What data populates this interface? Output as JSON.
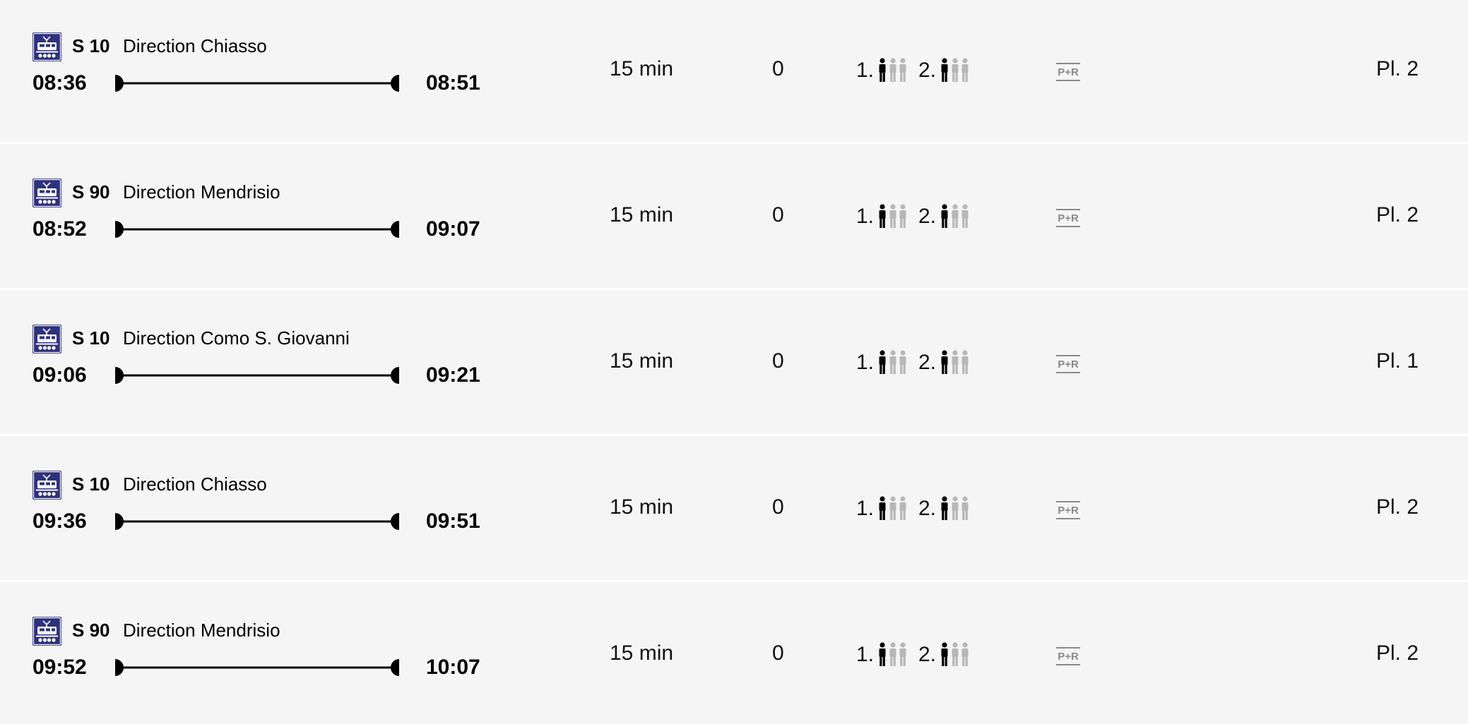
{
  "connections": [
    {
      "icon": "train-icon",
      "line": "S 10",
      "direction": "Direction Chiasso",
      "departure": "08:36",
      "arrival": "08:51",
      "duration": "15 min",
      "changes": "0",
      "occupancy": {
        "first_class_label": "1.",
        "second_class_label": "2.",
        "first_class_level": 1,
        "second_class_level": 1,
        "max_level": 3
      },
      "park_and_ride": "P+R",
      "platform": "Pl. 2"
    },
    {
      "icon": "train-icon",
      "line": "S 90",
      "direction": "Direction Mendrisio",
      "departure": "08:52",
      "arrival": "09:07",
      "duration": "15 min",
      "changes": "0",
      "occupancy": {
        "first_class_label": "1.",
        "second_class_label": "2.",
        "first_class_level": 1,
        "second_class_level": 1,
        "max_level": 3
      },
      "park_and_ride": "P+R",
      "platform": "Pl. 2"
    },
    {
      "icon": "train-icon",
      "line": "S 10",
      "direction": "Direction Como S. Giovanni",
      "departure": "09:06",
      "arrival": "09:21",
      "duration": "15 min",
      "changes": "0",
      "occupancy": {
        "first_class_label": "1.",
        "second_class_label": "2.",
        "first_class_level": 1,
        "second_class_level": 1,
        "max_level": 3
      },
      "park_and_ride": "P+R",
      "platform": "Pl. 1"
    },
    {
      "icon": "train-icon",
      "line": "S 10",
      "direction": "Direction Chiasso",
      "departure": "09:36",
      "arrival": "09:51",
      "duration": "15 min",
      "changes": "0",
      "occupancy": {
        "first_class_label": "1.",
        "second_class_label": "2.",
        "first_class_level": 1,
        "second_class_level": 1,
        "max_level": 3
      },
      "park_and_ride": "P+R",
      "platform": "Pl. 2"
    },
    {
      "icon": "train-icon",
      "line": "S 90",
      "direction": "Direction Mendrisio",
      "departure": "09:52",
      "arrival": "10:07",
      "duration": "15 min",
      "changes": "0",
      "occupancy": {
        "first_class_label": "1.",
        "second_class_label": "2.",
        "first_class_level": 1,
        "second_class_level": 1,
        "max_level": 3
      },
      "park_and_ride": "P+R",
      "platform": "Pl. 2"
    }
  ],
  "colors": {
    "background": "#f5f5f5",
    "row_divider": "#ffffff",
    "text": "#000000",
    "train_icon_bg": "#2d327d",
    "occupancy_active": "#000000",
    "occupancy_inactive": "#b7b7b7",
    "pr_icon": "#8a8a8a"
  }
}
